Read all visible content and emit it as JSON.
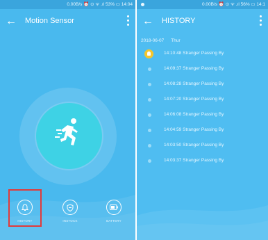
{
  "left": {
    "statusbar": "0.00B/s ⏰ ⊙ ᯤ .ıl 53% ▭ 14:04",
    "title": "Motion Sensor",
    "bottom": [
      {
        "label": "HISTORY",
        "icon": "bell-icon"
      },
      {
        "label": "INSTOCK",
        "icon": "shield-icon"
      },
      {
        "label": "BATTERY",
        "icon": "battery-icon"
      }
    ]
  },
  "right": {
    "statusbar": "0.00B/s ⏰ ⊙ ᯤ .ıl 56% ▭ 14:1",
    "title": "HISTORY",
    "date": "2018-06-07",
    "day": "Thur",
    "entries": [
      {
        "time": "14:10:48",
        "text": "Stranger Passing By"
      },
      {
        "time": "14:09:37",
        "text": "Stranger Passing By"
      },
      {
        "time": "14:08:28",
        "text": "Stranger Passing By"
      },
      {
        "time": "14:07:20",
        "text": "Stranger Passing By"
      },
      {
        "time": "14:06:08",
        "text": "Stranger Passing By"
      },
      {
        "time": "14:04:59",
        "text": "Stranger Passing By"
      },
      {
        "time": "14:03:50",
        "text": "Stranger Passing By"
      },
      {
        "time": "14:03:37",
        "text": "Stranger Passing By"
      }
    ]
  },
  "colors": {
    "accent": "#49b9ee",
    "circle": "#3ed2e5",
    "highlight": "#e23a3a",
    "bell": "#f5c62b"
  }
}
